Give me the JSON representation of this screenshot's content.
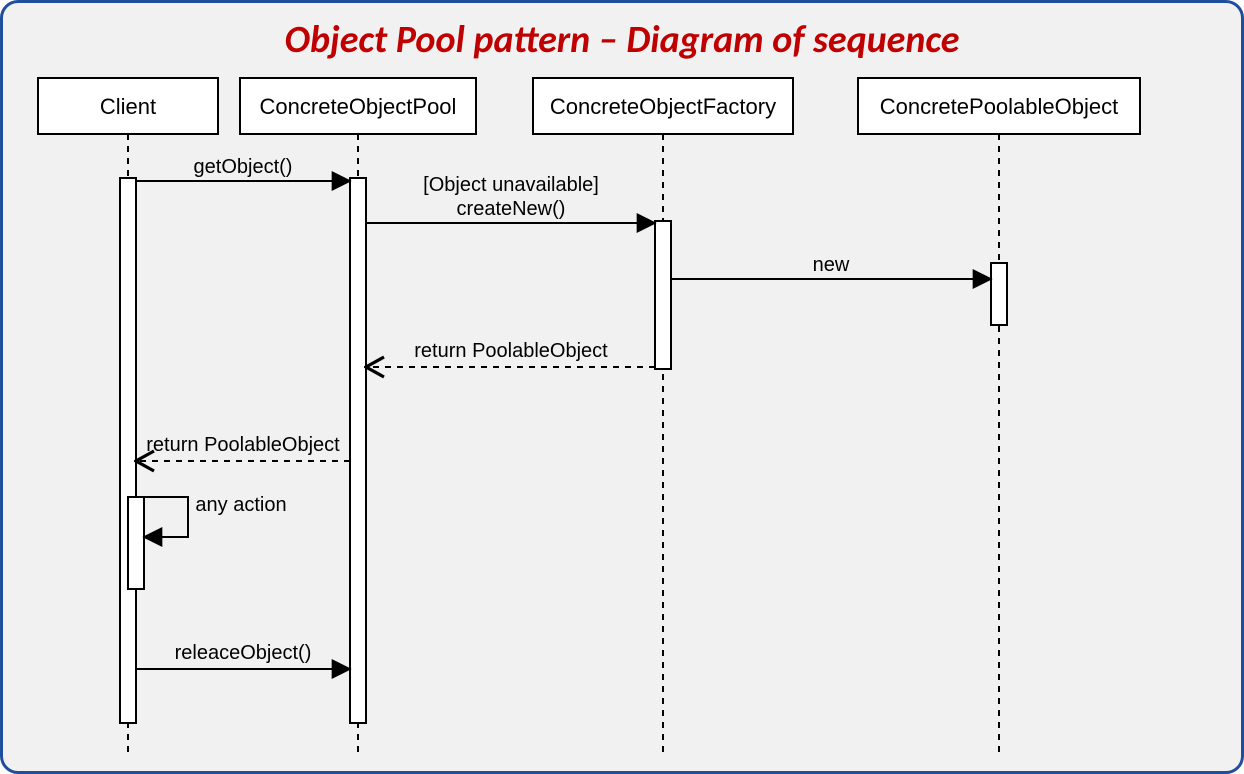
{
  "title": "Object Pool pattern – Diagram of sequence",
  "participants": {
    "client": "Client",
    "pool": "ConcreteObjectPool",
    "factory": "ConcreteObjectFactory",
    "obj": "ConcretePoolableObject"
  },
  "messages": {
    "getObject": "getObject()",
    "guard": "[Object unavailable]",
    "createNew": "createNew()",
    "new": "new",
    "returnPoolable1": "return PoolableObject",
    "returnPoolable2": "return PoolableObject",
    "anyAction": "any action",
    "releaseObject": "releaceObject()"
  }
}
